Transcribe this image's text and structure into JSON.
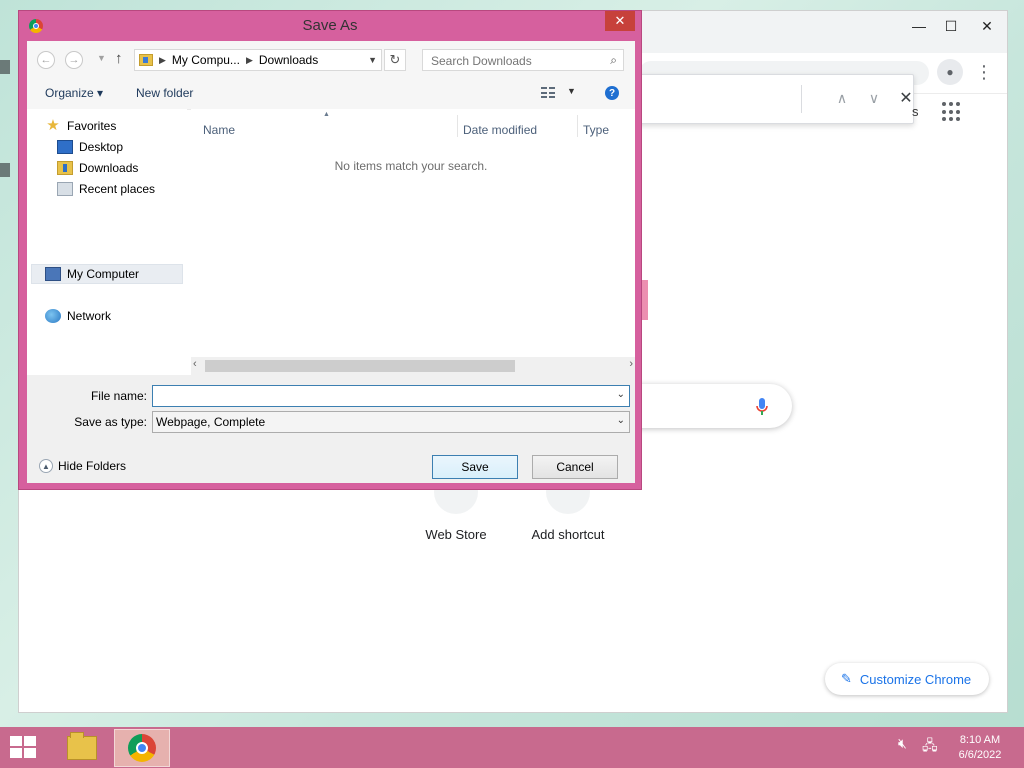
{
  "browser": {
    "find_bar": {
      "prev": "∧",
      "next": "∨",
      "close": "✕"
    },
    "gmail_partial": "s",
    "shortcuts": [
      {
        "label": "Web Store"
      },
      {
        "label": "Add shortcut"
      }
    ],
    "customize_label": "Customize Chrome"
  },
  "dialog": {
    "title": "Save As",
    "close": "✕",
    "address": {
      "crumbs": [
        "My Compu...",
        "Downloads"
      ]
    },
    "search": {
      "placeholder": "Search Downloads"
    },
    "toolbar": {
      "organize": "Organize ▾",
      "new_folder": "New folder"
    },
    "nav": {
      "favorites": "Favorites",
      "desktop": "Desktop",
      "downloads": "Downloads",
      "recent": "Recent places",
      "my_computer": "My Computer",
      "network": "Network"
    },
    "columns": {
      "name": "Name",
      "date_modified": "Date modified",
      "type": "Type"
    },
    "empty_message": "No items match your search.",
    "file_name_label": "File name:",
    "file_name_value": "",
    "save_as_type_label": "Save as type:",
    "save_as_type_value": "Webpage, Complete",
    "hide_folders": "Hide Folders",
    "save_button": "Save",
    "cancel_button": "Cancel"
  },
  "taskbar": {
    "time": "8:10 AM",
    "date": "6/6/2022",
    "items": [
      {
        "icon": "file-explorer-icon"
      },
      {
        "icon": "chrome-icon",
        "active": true
      }
    ]
  },
  "colors": {
    "dialog_frame": "#d6609e",
    "close_button": "#c7413b",
    "taskbar": "#c86a8e",
    "chrome_blue": "#1a73e8"
  }
}
